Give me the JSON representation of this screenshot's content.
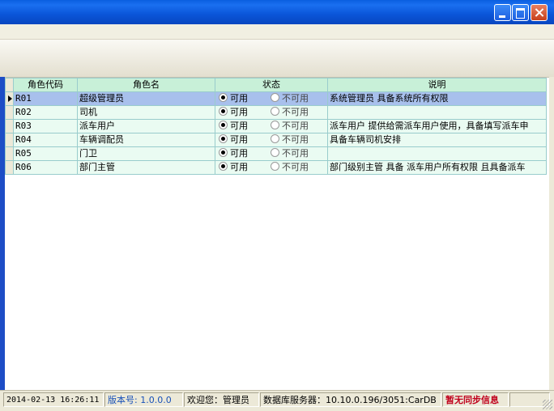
{
  "window": {
    "controls": [
      "minimize-icon",
      "maximize-icon",
      "close-icon"
    ],
    "title_color": "#0a55d8"
  },
  "grid": {
    "columns": [
      "角色代码",
      "角色名",
      "状态",
      "说明"
    ],
    "status_options": [
      "可用",
      "不可用"
    ],
    "rows": [
      {
        "code": "R01",
        "name": "超级管理员",
        "status": "可用",
        "desc": "系统管理员 具备系统所有权限",
        "selected": true
      },
      {
        "code": "R02",
        "name": "司机",
        "status": "可用",
        "desc": ""
      },
      {
        "code": "R03",
        "name": "派车用户",
        "status": "可用",
        "desc": "派车用户 提供给需派车用户使用，具备填写派车申"
      },
      {
        "code": "R04",
        "name": "车辆调配员",
        "status": "可用",
        "desc": "具备车辆司机安排"
      },
      {
        "code": "R05",
        "name": "门卫",
        "status": "可用",
        "desc": ""
      },
      {
        "code": "R06",
        "name": "部门主管",
        "status": "可用",
        "desc": "部门级别主管 具备 派车用户所有权限 且具备派车"
      }
    ]
  },
  "statusbar": {
    "datetime": "2014-02-13 16:26:11",
    "version": "版本号: 1.0.0.0",
    "welcome": "欢迎您：管理员",
    "db_server": "数据库服务器：10.10.0.196/3051:CarDB",
    "sync": "暂无同步信息"
  }
}
